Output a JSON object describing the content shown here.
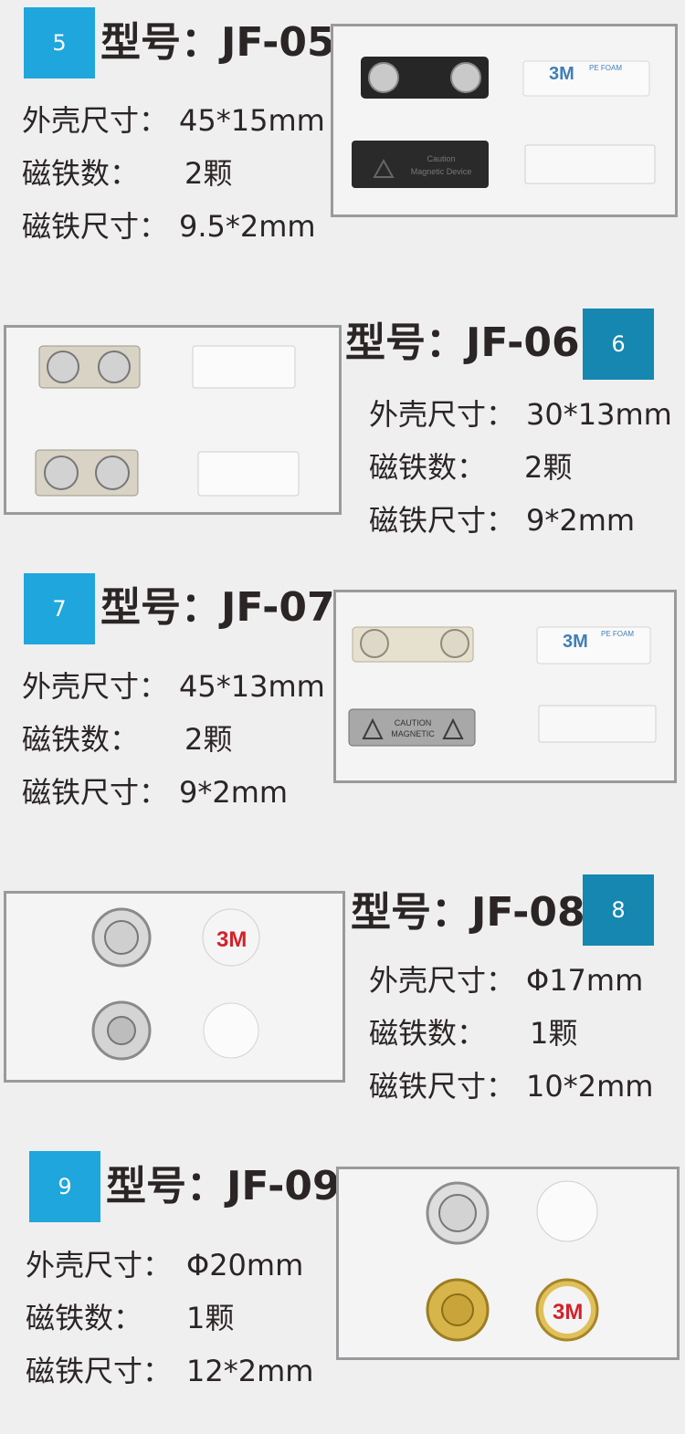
{
  "products": [
    {
      "badge": "5",
      "title": "型号：JF-05",
      "specs": [
        {
          "key": "外壳尺寸：",
          "value": "45*15mm"
        },
        {
          "key": "磁铁数：",
          "value": "2颗"
        },
        {
          "key": "磁铁尺寸：",
          "value": "9.5*2mm"
        }
      ]
    },
    {
      "badge": "6",
      "title": "型号：JF-06",
      "specs": [
        {
          "key": "外壳尺寸：",
          "value": "30*13mm"
        },
        {
          "key": "磁铁数：",
          "value": "2颗"
        },
        {
          "key": "磁铁尺寸：",
          "value": "9*2mm"
        }
      ]
    },
    {
      "badge": "7",
      "title": "型号：JF-07",
      "specs": [
        {
          "key": "外壳尺寸：",
          "value": "45*13mm"
        },
        {
          "key": "磁铁数：",
          "value": "2颗"
        },
        {
          "key": "磁铁尺寸：",
          "value": "9*2mm"
        }
      ]
    },
    {
      "badge": "8",
      "title": "型号：JF-08",
      "specs": [
        {
          "key": "外壳尺寸：",
          "value": "Φ17mm"
        },
        {
          "key": "磁铁数：",
          "value": "1颗"
        },
        {
          "key": "磁铁尺寸：",
          "value": "10*2mm"
        }
      ]
    },
    {
      "badge": "9",
      "title": "型号：JF-09",
      "specs": [
        {
          "key": "外壳尺寸：",
          "value": "Φ20mm"
        },
        {
          "key": "磁铁数：",
          "value": "1颗"
        },
        {
          "key": "磁铁尺寸：",
          "value": "12*2mm"
        }
      ]
    }
  ],
  "photo_text": {
    "tape_brand": "3M",
    "tape_sub": "PE FOAM",
    "jf05_caution_1": "Caution",
    "jf05_caution_2": "Magnetic Device",
    "jf07_caution_1": "CAUTION",
    "jf07_caution_2": "MAGNETIC"
  },
  "colors": {
    "badge_light": "#1fa6dd",
    "badge_dark": "#1587b0",
    "text": "#2b2525",
    "frame_border": "#9a9a9d"
  }
}
